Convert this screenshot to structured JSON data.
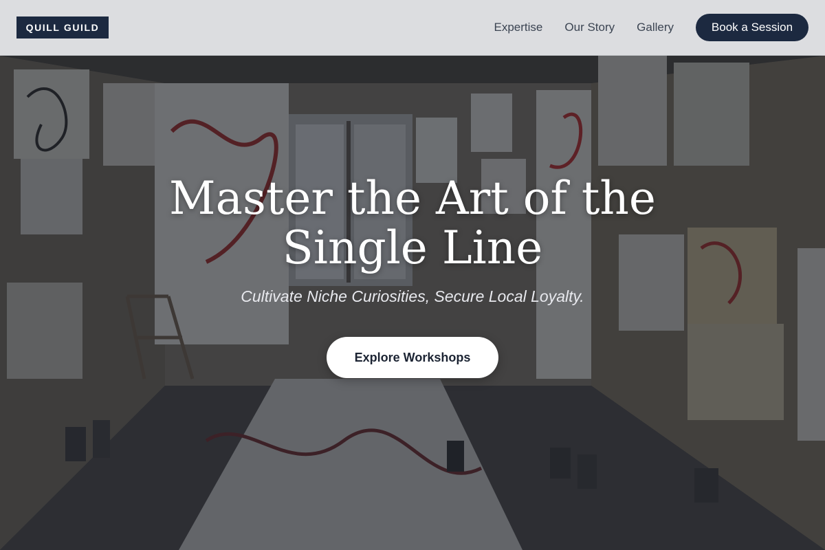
{
  "header": {
    "logo_text": "QUILL GUILD",
    "nav": [
      {
        "label": "Expertise"
      },
      {
        "label": "Our Story"
      },
      {
        "label": "Gallery"
      }
    ],
    "cta_label": "Book a Session"
  },
  "hero": {
    "title_line1": "Master the Art of the",
    "title_line2": "Single Line",
    "subtitle": "Cultivate Niche Curiosities, Secure Local Loyalty.",
    "cta_label": "Explore Workshops",
    "background": "artist-studio-photo"
  },
  "colors": {
    "brand_navy": "#1c2940",
    "header_bg": "#dcdde0",
    "nav_text": "#3b4452",
    "hero_overlay": "#121828",
    "cta_bg": "#ffffff"
  }
}
